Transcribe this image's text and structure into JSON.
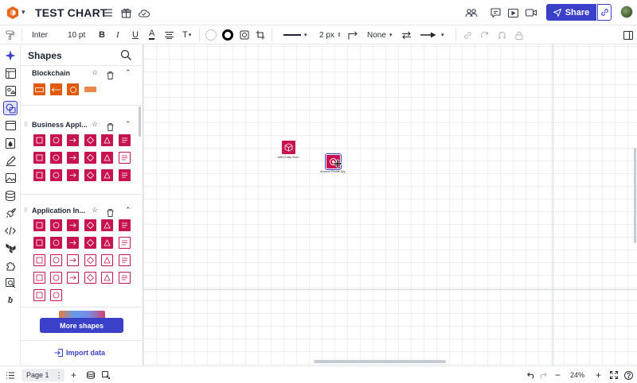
{
  "topbar": {
    "title": "TEST CHART",
    "share_label": "Share"
  },
  "format": {
    "font": "Inter",
    "font_size": "10 pt",
    "bold": "B",
    "italic": "I",
    "underline": "U",
    "text_color": "A",
    "text_option": "T",
    "line_width": "2 px",
    "endpoint": "None"
  },
  "panel": {
    "title": "Shapes",
    "sections": [
      {
        "title": "Blockchain"
      },
      {
        "title": "Business Appl..."
      },
      {
        "title": "Application In..."
      }
    ],
    "more_label": "More shapes",
    "import_label": "Import data"
  },
  "canvas": {
    "nodes": [
      {
        "label": "AWS Entity Store"
      },
      {
        "label": "Amazon Private App"
      }
    ]
  },
  "bottombar": {
    "page_label": "Page 1",
    "zoom": "24%"
  },
  "colors": {
    "accent": "#3b40c8",
    "aws_magenta": "#c7134f",
    "aws_orange": "#e05a0c"
  }
}
